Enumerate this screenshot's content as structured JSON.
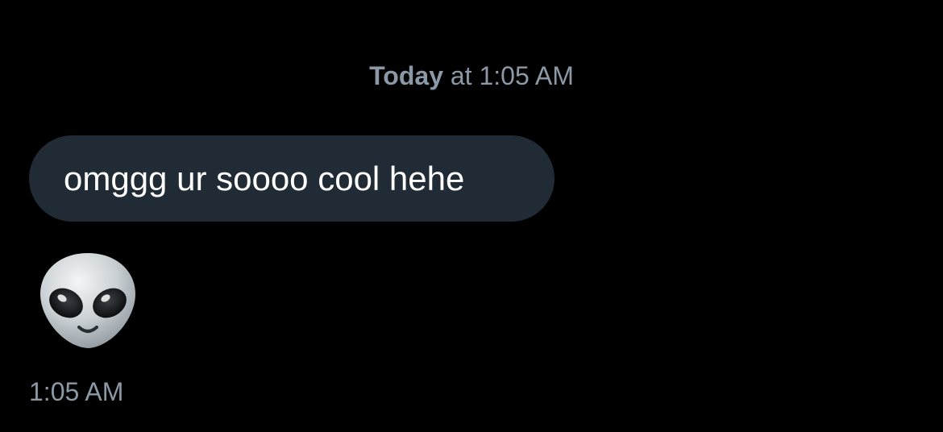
{
  "header": {
    "day_label": "Today",
    "time_label": " at 1:05 AM"
  },
  "messages": [
    {
      "type": "text",
      "text": "omggg ur soooo cool hehe"
    },
    {
      "type": "emoji",
      "icon": "alien-icon"
    }
  ],
  "last_message_time": "1:05 AM",
  "colors": {
    "background": "#000000",
    "bubble": "#202b36",
    "meta_text": "#8b98a5",
    "message_text": "#ffffff"
  }
}
